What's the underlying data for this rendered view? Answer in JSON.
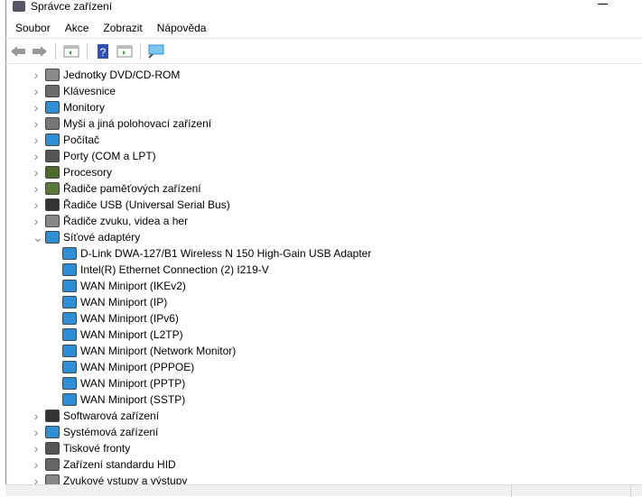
{
  "window": {
    "title": "Správce zařízení"
  },
  "menu": [
    "Soubor",
    "Akce",
    "Zobrazit",
    "Nápověda"
  ],
  "toolbar": [
    {
      "icon": "back-icon"
    },
    {
      "icon": "forward-icon"
    },
    {
      "icon": "properties-icon"
    },
    {
      "icon": "help-icon"
    },
    {
      "icon": "update-driver-icon"
    },
    {
      "icon": "scan-hardware-icon"
    }
  ],
  "tree": [
    {
      "label": "Jednotky DVD/CD-ROM",
      "level": 0,
      "expander": "collapsed",
      "color": "#8a8a8a"
    },
    {
      "label": "Klávesnice",
      "level": 0,
      "expander": "collapsed",
      "color": "#6b6b6b"
    },
    {
      "label": "Monitory",
      "level": 0,
      "expander": "collapsed",
      "color": "#2d8fd6"
    },
    {
      "label": "Myši a jiná polohovací zařízení",
      "level": 0,
      "expander": "collapsed",
      "color": "#777"
    },
    {
      "label": "Počítač",
      "level": 0,
      "expander": "collapsed",
      "color": "#2d8fd6"
    },
    {
      "label": "Porty (COM a LPT)",
      "level": 0,
      "expander": "collapsed",
      "color": "#555"
    },
    {
      "label": "Procesory",
      "level": 0,
      "expander": "collapsed",
      "color": "#4b6b2b"
    },
    {
      "label": "Řadiče paměťových zařízení",
      "level": 0,
      "expander": "collapsed",
      "color": "#5a7a3a"
    },
    {
      "label": "Řadiče USB (Universal Serial Bus)",
      "level": 0,
      "expander": "collapsed",
      "color": "#333"
    },
    {
      "label": "Řadiče zvuku, videa a her",
      "level": 0,
      "expander": "collapsed",
      "color": "#888"
    },
    {
      "label": "Síťové adaptéry",
      "level": 0,
      "expander": "expanded",
      "color": "#2d8fd6"
    },
    {
      "label": "D-Link DWA-127/B1 Wireless N 150 High-Gain USB Adapter",
      "level": 1,
      "color": "#2d8fd6"
    },
    {
      "label": "Intel(R) Ethernet Connection (2) I219-V",
      "level": 1,
      "color": "#2d8fd6"
    },
    {
      "label": "WAN Miniport (IKEv2)",
      "level": 1,
      "color": "#2d8fd6"
    },
    {
      "label": "WAN Miniport (IP)",
      "level": 1,
      "color": "#2d8fd6"
    },
    {
      "label": "WAN Miniport (IPv6)",
      "level": 1,
      "color": "#2d8fd6"
    },
    {
      "label": "WAN Miniport (L2TP)",
      "level": 1,
      "color": "#2d8fd6"
    },
    {
      "label": "WAN Miniport (Network Monitor)",
      "level": 1,
      "color": "#2d8fd6"
    },
    {
      "label": "WAN Miniport (PPPOE)",
      "level": 1,
      "color": "#2d8fd6"
    },
    {
      "label": "WAN Miniport (PPTP)",
      "level": 1,
      "color": "#2d8fd6"
    },
    {
      "label": "WAN Miniport (SSTP)",
      "level": 1,
      "color": "#2d8fd6"
    },
    {
      "label": "Softwarová zařízení",
      "level": 0,
      "expander": "collapsed",
      "color": "#333"
    },
    {
      "label": "Systémová zařízení",
      "level": 0,
      "expander": "collapsed",
      "color": "#2d8fd6"
    },
    {
      "label": "Tiskové fronty",
      "level": 0,
      "expander": "collapsed",
      "color": "#555"
    },
    {
      "label": "Zařízení standardu HID",
      "level": 0,
      "expander": "collapsed",
      "color": "#666"
    },
    {
      "label": "Zvukové vstupy a výstupy",
      "level": 0,
      "expander": "collapsed",
      "color": "#888"
    }
  ]
}
